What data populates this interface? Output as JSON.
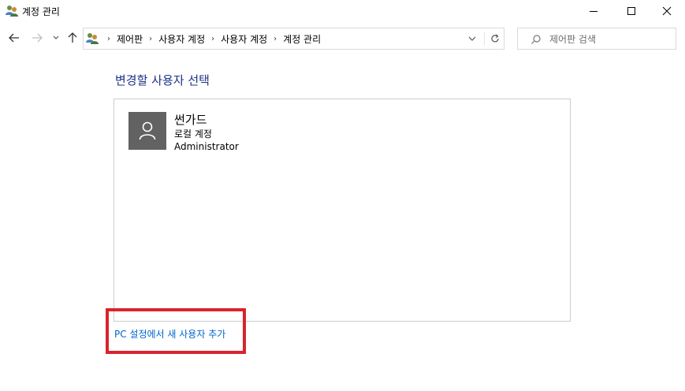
{
  "window": {
    "title": "계정 관리",
    "app_icon": "user-accounts-icon",
    "controls": [
      "minimize-icon",
      "maximize-icon",
      "close-icon"
    ]
  },
  "navigation": {
    "back_icon": "back-arrow-icon",
    "forward_icon": "forward-arrow-icon",
    "recent_icon": "chevron-down-icon",
    "up_icon": "up-arrow-icon"
  },
  "address": {
    "icon": "user-accounts-icon",
    "breadcrumbs": [
      "제어판",
      "사용자 계정",
      "사용자 계정",
      "계정 관리"
    ],
    "separator": "›"
  },
  "search": {
    "placeholder": "제어판 검색"
  },
  "main": {
    "heading": "변경할 사용자 선택",
    "accounts": [
      {
        "name": "썬가드",
        "type": "로컬 계정",
        "role": "Administrator",
        "avatar_icon": "user-avatar-icon"
      }
    ],
    "add_user_link": "PC 설정에서 새 사용자 추가"
  },
  "colors": {
    "heading": "#1e3287",
    "link": "#0066cc",
    "highlight": "#d9232d",
    "avatar_bg": "#626262"
  }
}
